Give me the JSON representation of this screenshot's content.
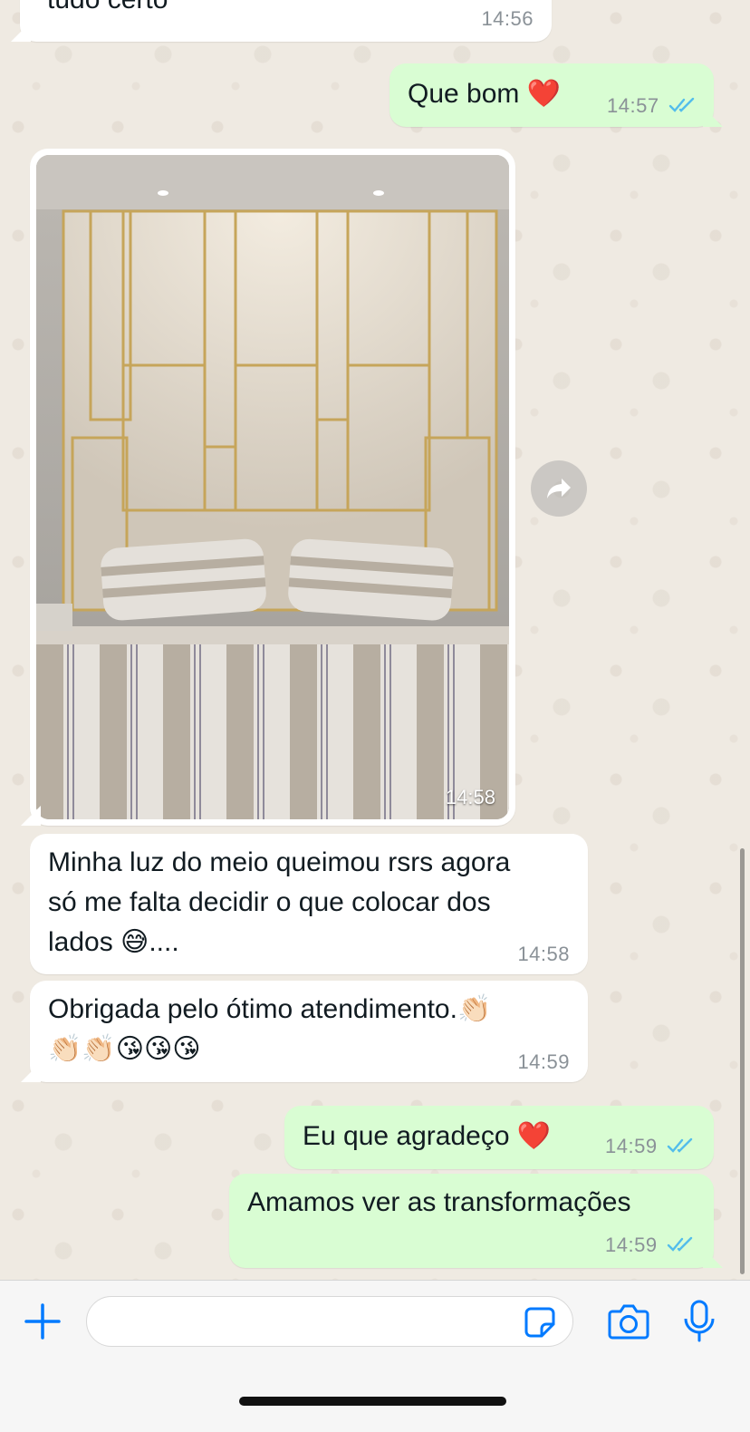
{
  "colors": {
    "chat_background": "#efeae2",
    "incoming_bubble": "#ffffff",
    "outgoing_bubble": "#d9fdd3",
    "read_ticks": "#53bdeb",
    "accent": "#007aff"
  },
  "messages": [
    {
      "id": "m1",
      "direction": "incoming",
      "text": "tudo certo",
      "time": "14:56"
    },
    {
      "id": "m2",
      "direction": "outgoing",
      "text": "Que bom ❤️",
      "time": "14:57",
      "status": "read"
    },
    {
      "id": "m3",
      "direction": "incoming",
      "type": "image",
      "image_description": "Bedroom with padded beige headboard panels with gold trim, striped bedding and pillows",
      "time": "14:58"
    },
    {
      "id": "m4",
      "direction": "incoming",
      "text": "Minha luz do meio queimou rsrs agora\nsó me falta decidir o que colocar dos\nlados 😅....",
      "time": "14:58"
    },
    {
      "id": "m5",
      "direction": "incoming",
      "text": "Obrigada pelo ótimo atendimento.👏🏻\n👏🏻👏🏻😘😘😘",
      "time": "14:59"
    },
    {
      "id": "m6",
      "direction": "outgoing",
      "text": "Eu que agradeço ❤️",
      "time": "14:59",
      "status": "read"
    },
    {
      "id": "m7",
      "direction": "outgoing",
      "text": "Amamos ver as transformações",
      "time": "14:59",
      "status": "read"
    }
  ],
  "input_bar": {
    "placeholder": "",
    "icons": [
      "plus-icon",
      "sticker-icon",
      "camera-icon",
      "microphone-icon"
    ]
  }
}
